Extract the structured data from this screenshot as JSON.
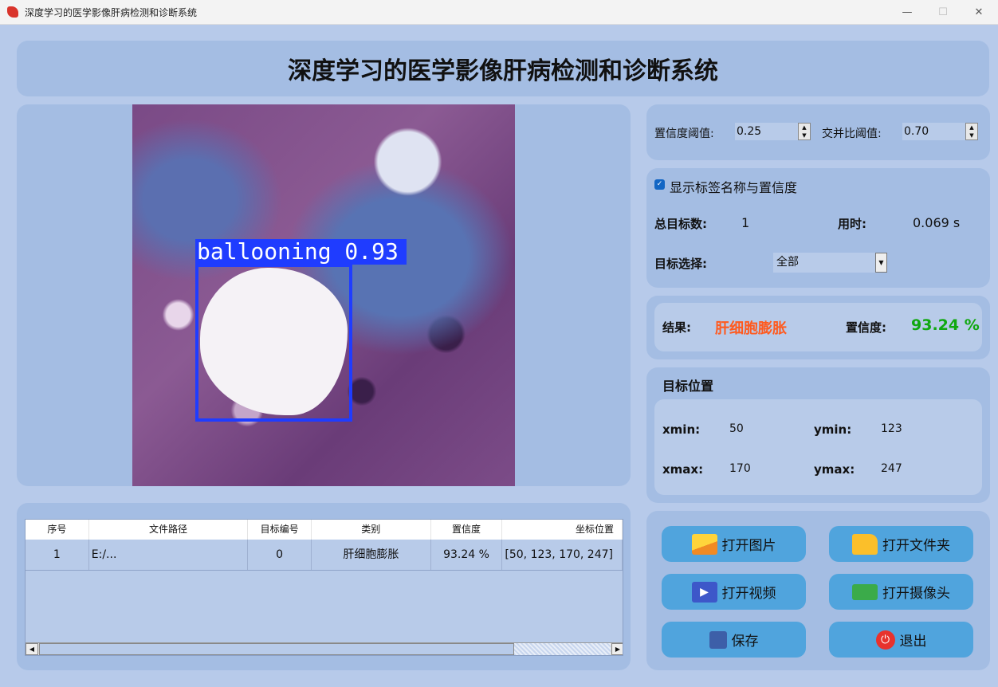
{
  "window": {
    "title": "深度学习的医学影像肝病检测和诊断系统",
    "minimize": "—",
    "maximize": "☐",
    "close": "✕"
  },
  "header": {
    "title": "深度学习的医学影像肝病检测和诊断系统"
  },
  "image": {
    "detection_label": "ballooning 0.93"
  },
  "table": {
    "headers": [
      "序号",
      "文件路径",
      "目标编号",
      "类别",
      "置信度",
      "坐标位置"
    ],
    "rows": [
      [
        "1",
        "E:/...",
        "0",
        "肝细胞膨胀",
        "93.24 %",
        "[50, 123, 170, 247]"
      ]
    ]
  },
  "params": {
    "conf_label": "置信度阈值:",
    "conf_value": "0.25",
    "iou_label": "交并比阈值:",
    "iou_value": "0.70"
  },
  "info": {
    "show_label": "显示标签名称与置信度",
    "show_checked": true,
    "total_label": "总目标数:",
    "total_value": "1",
    "time_label": "用时:",
    "time_value": "0.069 s",
    "select_label": "目标选择:",
    "select_value": "全部"
  },
  "result": {
    "label": "结果:",
    "value": "肝细胞膨胀",
    "conf_label": "置信度:",
    "conf_value": "93.24 %",
    "value_color": "#ff5a1f",
    "conf_color": "#10a810"
  },
  "position": {
    "title": "目标位置",
    "xmin_label": "xmin:",
    "xmin": "50",
    "ymin_label": "ymin:",
    "ymin": "123",
    "xmax_label": "xmax:",
    "xmax": "170",
    "ymax_label": "ymax:",
    "ymax": "247"
  },
  "buttons": {
    "open_image": "打开图片",
    "open_folder": "打开文件夹",
    "open_video": "打开视频",
    "open_camera": "打开摄像头",
    "save": "保存",
    "exit": "退出"
  }
}
